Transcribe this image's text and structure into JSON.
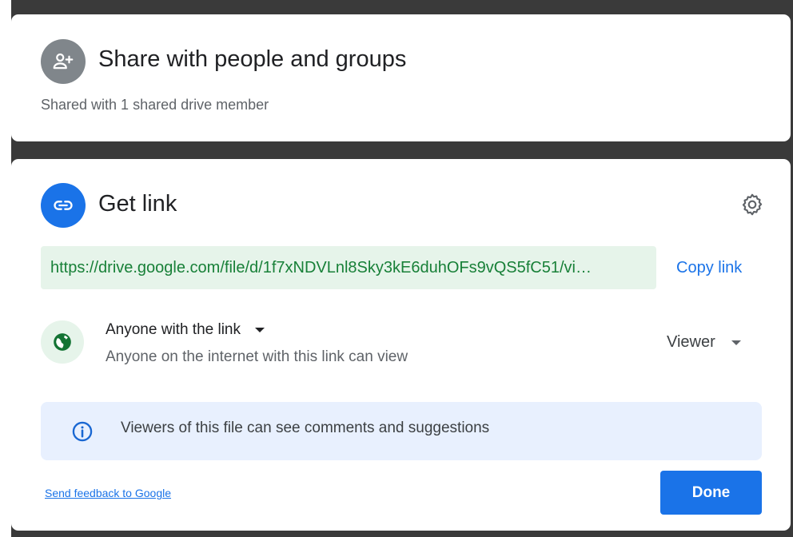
{
  "share": {
    "title": "Share with people and groups",
    "subtitle": "Shared with 1 shared drive member"
  },
  "link": {
    "title": "Get link",
    "url": "https://drive.google.com/file/d/1f7xNDVLnl8Sky3kE6duhOFs9vQS5fC51/vi…",
    "copy_label": "Copy link",
    "access_label": "Anyone with the link",
    "access_description": "Anyone on the internet with this link can view",
    "role_label": "Viewer",
    "info_text": "Viewers of this file can see comments and suggestions",
    "feedback_label": "Send feedback to Google",
    "done_label": "Done"
  },
  "icons": {
    "share": "add-person-icon",
    "link": "link-icon",
    "settings": "gear-icon",
    "access": "globe-icon",
    "info": "info-icon"
  },
  "colors": {
    "accent": "#1a73e8",
    "url_text": "#188038",
    "url_bg": "#e6f4ea",
    "info_bg": "#e8f0fe"
  }
}
